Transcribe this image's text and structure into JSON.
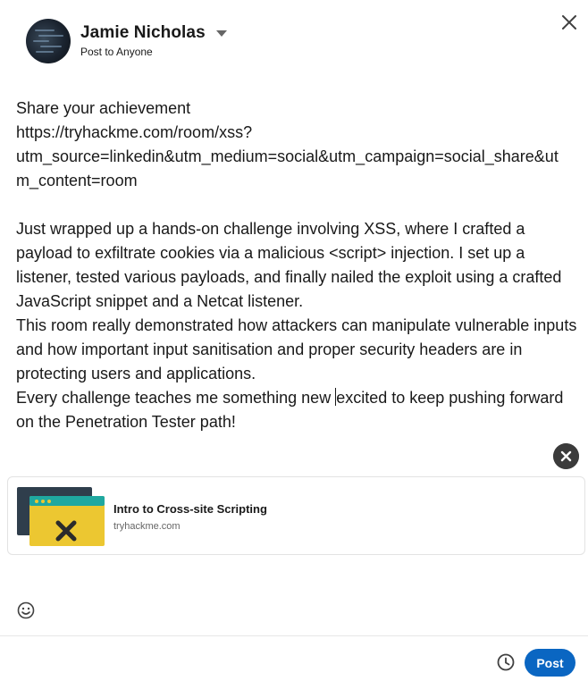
{
  "header": {
    "user_name": "Jamie Nicholas",
    "audience": "Post to Anyone",
    "icons": {
      "dropdown": "chevron-down-icon",
      "close": "close-icon",
      "avatar": "profile-photo"
    }
  },
  "post": {
    "lines": [
      "Share your achievement",
      "https://tryhackme.com/room/xss?",
      "utm_source=linkedin&utm_medium=social&utm_campaign=social_share&ut",
      "m_content=room",
      "",
      "Just wrapped up a hands-on challenge involving XSS, where I crafted a",
      "payload to exfiltrate cookies via a malicious <script> injection. I set up a",
      "listener, tested various payloads, and finally nailed the exploit using a crafted",
      "JavaScript snippet and a Netcat listener.",
      "This room really demonstrated how attackers can manipulate vulnerable inputs",
      "and how important input sanitisation and proper security headers are in",
      "protecting users and applications."
    ],
    "line_last_before_cursor": "Every challenge teaches me something new ",
    "line_last_after_cursor": "excited to keep pushing forward",
    "line_final": "on the Penetration Tester path!"
  },
  "link_preview": {
    "title": "Intro to Cross-site Scripting",
    "domain": "tryhackme.com",
    "icons": {
      "remove": "close-icon",
      "thumbnail": "browser-window-x-icon"
    }
  },
  "toolbar": {
    "post_label": "Post",
    "icons": {
      "emoji": "smiley-icon",
      "schedule": "clock-icon"
    }
  },
  "colors": {
    "accent": "#0a66c2",
    "text": "#191919",
    "muted": "#666666",
    "thumb_back": "#2f3e4c",
    "thumb_front": "#ecc731",
    "thumb_bar": "#1fa8a0"
  }
}
